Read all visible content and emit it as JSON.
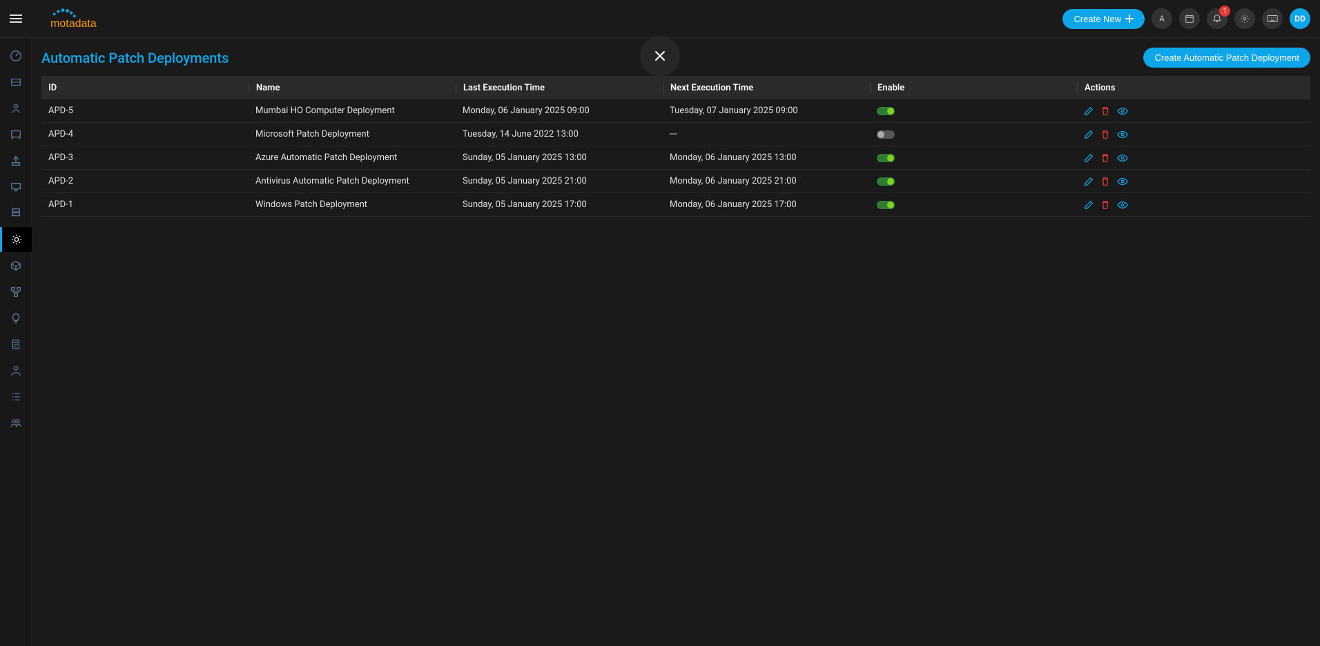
{
  "header": {
    "create_new_label": "Create New",
    "letter_button": "A",
    "notification_count": "1",
    "avatar_initials": "DD"
  },
  "page": {
    "title": "Automatic Patch Deployments",
    "create_button_label": "Create Automatic Patch Deployment"
  },
  "table": {
    "columns": {
      "id": "ID",
      "name": "Name",
      "last_exec": "Last Execution Time",
      "next_exec": "Next Execution Time",
      "enable": "Enable",
      "actions": "Actions"
    },
    "rows": [
      {
        "id": "APD-5",
        "name": "Mumbai HO Computer Deployment",
        "last_exec": "Monday, 06 January 2025 09:00",
        "next_exec": "Tuesday, 07 January 2025 09:00",
        "enabled": true
      },
      {
        "id": "APD-4",
        "name": "Microsoft Patch Deployment",
        "last_exec": "Tuesday, 14 June 2022 13:00",
        "next_exec": "---",
        "enabled": false
      },
      {
        "id": "APD-3",
        "name": "Azure Automatic Patch Deployment",
        "last_exec": "Sunday, 05 January 2025 13:00",
        "next_exec": "Monday, 06 January 2025 13:00",
        "enabled": true
      },
      {
        "id": "APD-2",
        "name": "Antivirus Automatic Patch Deployment",
        "last_exec": "Sunday, 05 January 2025 21:00",
        "next_exec": "Monday, 06 January 2025 21:00",
        "enabled": true
      },
      {
        "id": "APD-1",
        "name": "Windows Patch Deployment",
        "last_exec": "Sunday, 05 January 2025 17:00",
        "next_exec": "Monday, 06 January 2025 17:00",
        "enabled": true
      }
    ]
  },
  "sidebar": {
    "items": [
      "dashboard-icon",
      "ticket-icon",
      "user-icon",
      "asset-icon",
      "deploy-icon",
      "monitor-icon",
      "server-icon",
      "gear-icon",
      "cube-icon",
      "integration-icon",
      "idea-icon",
      "report-icon",
      "person-icon",
      "list-icon",
      "group-icon"
    ],
    "active_index": 7
  }
}
